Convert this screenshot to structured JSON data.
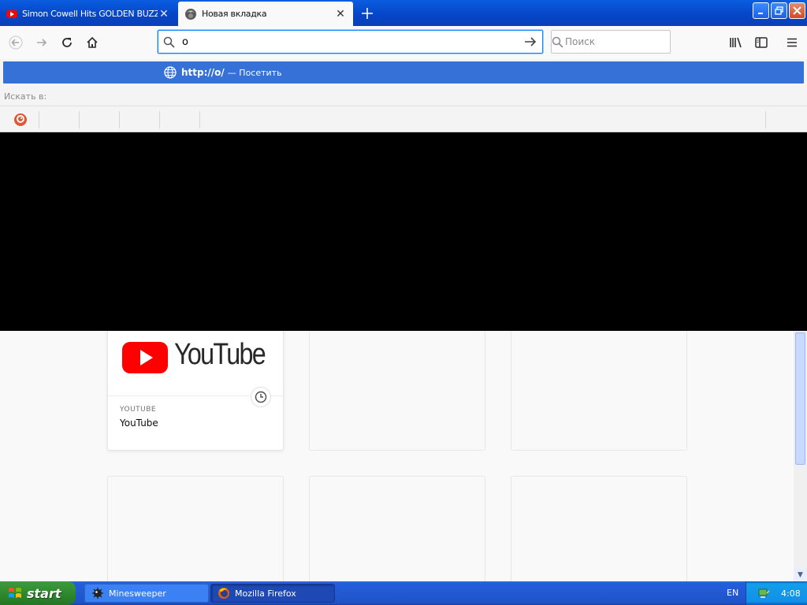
{
  "tabs": [
    {
      "title": "Simon Cowell Hits GOLDEN BUZZER",
      "favicon": "youtube-icon",
      "active": false
    },
    {
      "title": "Новая вкладка",
      "favicon": "firefox-icon",
      "active": true
    }
  ],
  "urlbar": {
    "value": "o"
  },
  "searchbar": {
    "placeholder": "Поиск"
  },
  "popup": {
    "suggestion_url": "http://o/",
    "suggestion_action": "— Посетить",
    "search_with": "Искать в:"
  },
  "tiles": [
    {
      "host": "YOUTUBE",
      "name": "YouTube",
      "logo_text": "YouTube"
    }
  ],
  "taskbar": {
    "start_label": "start",
    "tasks": [
      {
        "label": "Minesweeper"
      },
      {
        "label": "Mozilla Firefox"
      }
    ],
    "language": "EN",
    "clock": "4:08"
  },
  "colors": {
    "accent": "#0a84ff",
    "suggestion_highlight": "#3571d6",
    "youtube_red": "#ff0000"
  }
}
